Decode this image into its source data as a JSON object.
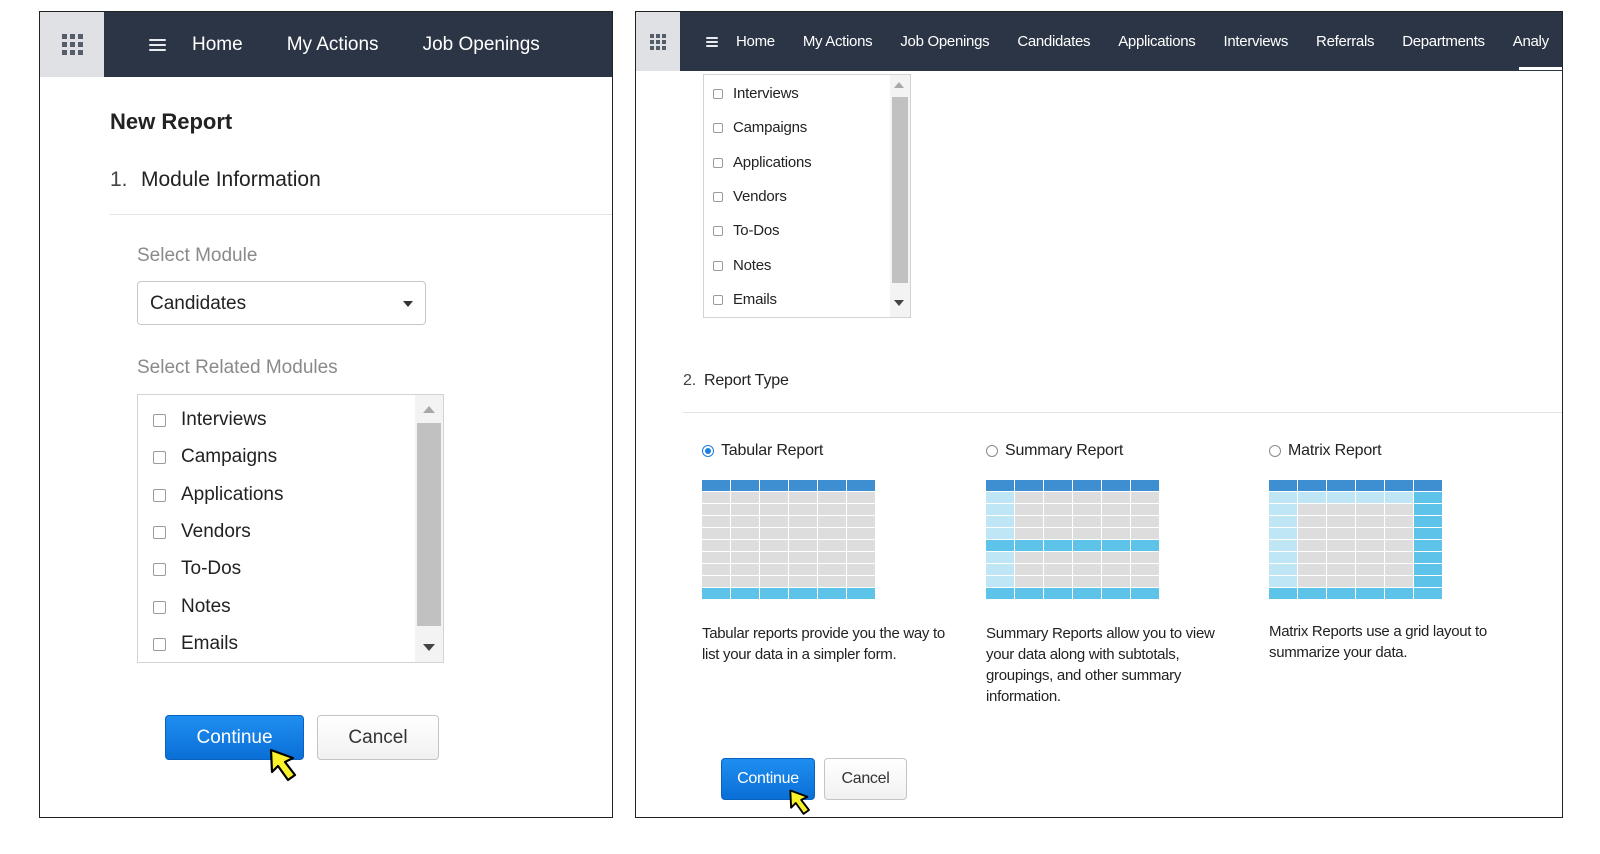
{
  "left": {
    "nav": [
      "Home",
      "My Actions",
      "Job Openings"
    ],
    "page_title": "New Report",
    "section1": {
      "num": "1.",
      "title": "Module Information"
    },
    "select_module_label": "Select Module",
    "selected_module": "Candidates",
    "related_label": "Select Related Modules",
    "related_modules": [
      "Interviews",
      "Campaigns",
      "Applications",
      "Vendors",
      "To-Dos",
      "Notes",
      "Emails"
    ],
    "continue_label": "Continue",
    "cancel_label": "Cancel"
  },
  "right": {
    "nav": [
      "Home",
      "My Actions",
      "Job Openings",
      "Candidates",
      "Applications",
      "Interviews",
      "Referrals",
      "Departments",
      "Analy"
    ],
    "related_modules": [
      "Interviews",
      "Campaigns",
      "Applications",
      "Vendors",
      "To-Dos",
      "Notes",
      "Emails"
    ],
    "section2": {
      "num": "2.",
      "title": "Report Type"
    },
    "report_types": [
      {
        "label": "Tabular Report",
        "checked": true,
        "description": "Tabular reports provide you the way to list your data in a simpler form."
      },
      {
        "label": "Summary Report",
        "checked": false,
        "description": "Summary Reports allow you to view your data along with subtotals, groupings, and other summary information."
      },
      {
        "label": "Matrix Report",
        "checked": false,
        "description": "Matrix Reports use a grid layout to summarize your data."
      }
    ],
    "continue_label": "Continue",
    "cancel_label": "Cancel"
  },
  "colors": {
    "topbar": "#2c3545",
    "primary_button": "#0a6fd6",
    "table_header": "#3d8fd1",
    "table_highlight": "#5ec3e8",
    "table_light": "#bfe6f4",
    "table_cell": "#dddddd",
    "cursor": "#f7f02a"
  },
  "icons": [
    "app-grid-icon",
    "hamburger-icon",
    "dropdown-caret-icon",
    "scroll-up-arrow-icon",
    "scroll-down-arrow-icon",
    "pointer-cursor-icon"
  ]
}
